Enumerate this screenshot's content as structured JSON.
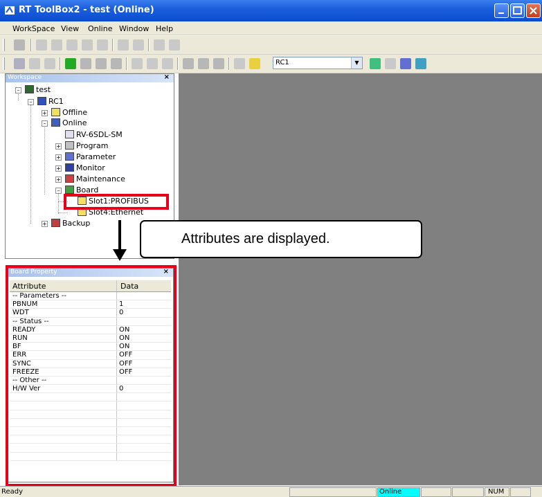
{
  "window": {
    "title": "RT ToolBox2 - test (Online)",
    "buttons": [
      "minimize",
      "maximize",
      "close"
    ]
  },
  "menu": [
    "WorkSpace",
    "View",
    "Online",
    "Window",
    "Help"
  ],
  "toolbar": {
    "robot_select": "RC1"
  },
  "workspace": {
    "panel_title": "Workspace",
    "close_glyph": "×",
    "tree": {
      "root": "test",
      "controller": "RC1",
      "offline": "Offline",
      "online": "Online",
      "robot_model": "RV-6SDL-SM",
      "program": "Program",
      "parameter": "Parameter",
      "monitor": "Monitor",
      "maintenance": "Maintenance",
      "board": "Board",
      "slot1": "Slot1:PROFIBUS",
      "slot4": "Slot4:Ethernet",
      "backup": "Backup"
    }
  },
  "callout": "Attributes are displayed.",
  "board_property": {
    "panel_title": "Board Property",
    "close_glyph": "×",
    "columns": [
      "Attribute",
      "Data"
    ],
    "rows": [
      [
        "-- Parameters --",
        ""
      ],
      [
        "PBNUM",
        "1"
      ],
      [
        "WDT",
        "0"
      ],
      [
        "-- Status --",
        ""
      ],
      [
        "READY",
        "ON"
      ],
      [
        "RUN",
        "ON"
      ],
      [
        "BF",
        "ON"
      ],
      [
        "ERR",
        "OFF"
      ],
      [
        "SYNC",
        "OFF"
      ],
      [
        "FREEZE",
        "OFF"
      ],
      [
        "-- Other --",
        ""
      ],
      [
        "H/W Ver",
        "0"
      ],
      [
        "",
        ""
      ],
      [
        "",
        ""
      ],
      [
        "",
        ""
      ],
      [
        "",
        ""
      ],
      [
        "",
        ""
      ],
      [
        "",
        ""
      ],
      [
        "",
        ""
      ],
      [
        "",
        ""
      ]
    ]
  },
  "status": {
    "left": "Ready",
    "mode": "Online",
    "num": "NUM"
  },
  "colors": {
    "highlight": "#e8001a",
    "online_status": "#00ffff",
    "mdi_background": "#808080"
  }
}
